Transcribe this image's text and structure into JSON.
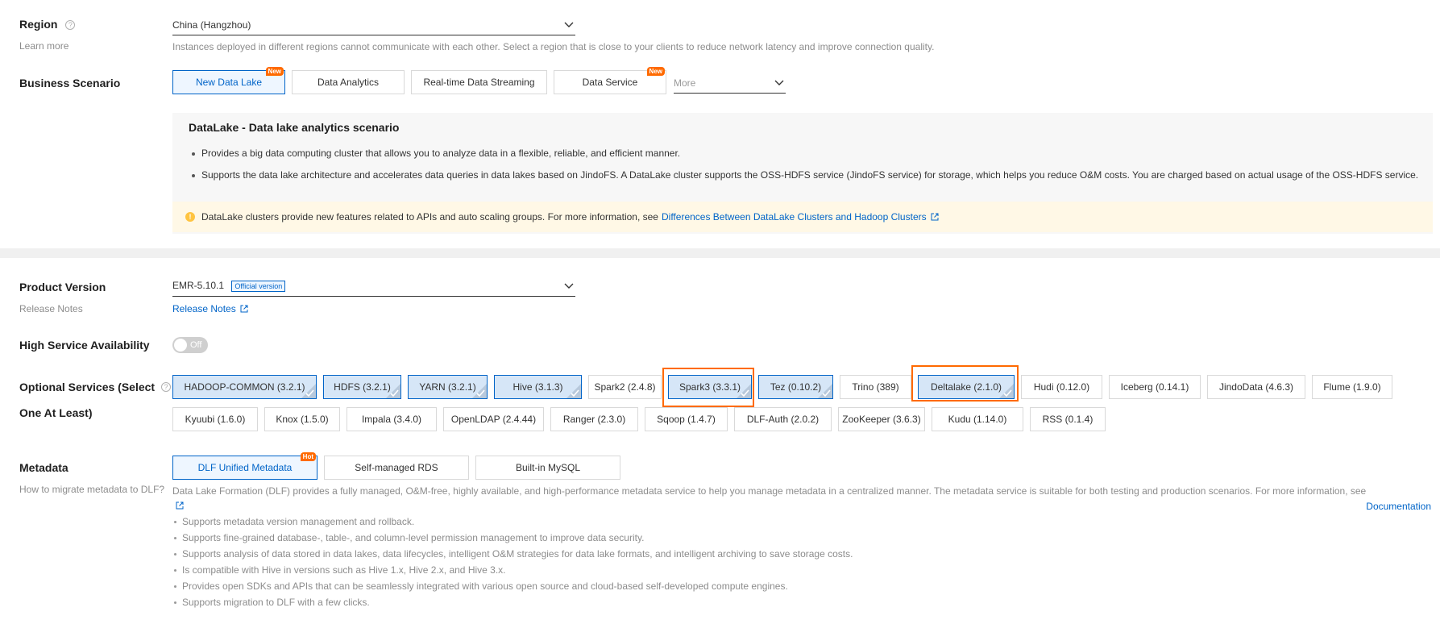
{
  "region": {
    "label": "Region",
    "learn_more": "Learn more",
    "value": "China (Hangzhou)",
    "hint": "Instances deployed in different regions cannot communicate with each other. Select a region that is close to your clients to reduce network latency and improve connection quality."
  },
  "business_scenario": {
    "label": "Business Scenario",
    "options": [
      {
        "label": "New Data Lake",
        "badge": "New",
        "selected": true
      },
      {
        "label": "Data Analytics"
      },
      {
        "label": "Real-time Data Streaming"
      },
      {
        "label": "Data Service",
        "badge": "New"
      }
    ],
    "more_placeholder": "More",
    "description": {
      "title": "DataLake - Data lake analytics scenario",
      "bullets": [
        "Provides a big data computing cluster that allows you to analyze data in a flexible, reliable, and efficient manner.",
        "Supports the data lake architecture and accelerates data queries in data lakes based on JindoFS. A DataLake cluster supports the OSS-HDFS service (JindoFS service) for storage, which helps you reduce O&M costs. You are charged based on actual usage of the OSS-HDFS service."
      ],
      "notice_text": "DataLake clusters provide new features related to APIs and auto scaling groups. For more information, see",
      "notice_link": "Differences Between DataLake Clusters and Hadoop Clusters"
    }
  },
  "product_version": {
    "label": "Product Version",
    "sub": "Release Notes",
    "value": "EMR-5.10.1",
    "tag": "Official version",
    "link": "Release Notes"
  },
  "ha": {
    "label": "High Service Availability",
    "toggle": "Off"
  },
  "optional_services": {
    "label_line1": "Optional Services (Select",
    "label_line2": "One At Least)",
    "row1": [
      {
        "label": "HADOOP-COMMON (3.2.1)",
        "checked": true
      },
      {
        "label": "HDFS (3.2.1)",
        "checked": true
      },
      {
        "label": "YARN (3.2.1)",
        "checked": true
      },
      {
        "label": "Hive (3.1.3)",
        "checked": true
      },
      {
        "label": "Spark2 (2.4.8)"
      },
      {
        "label": "Spark3 (3.3.1)",
        "checked": true
      },
      {
        "label": "Tez (0.10.2)",
        "checked": true
      },
      {
        "label": "Trino (389)"
      },
      {
        "label": "Deltalake (2.1.0)",
        "checked": true
      },
      {
        "label": "Hudi (0.12.0)"
      },
      {
        "label": "Iceberg (0.14.1)"
      },
      {
        "label": "JindoData (4.6.3)"
      },
      {
        "label": "Flume (1.9.0)"
      }
    ],
    "row2": [
      {
        "label": "Kyuubi (1.6.0)"
      },
      {
        "label": "Knox (1.5.0)"
      },
      {
        "label": "Impala (3.4.0)"
      },
      {
        "label": "OpenLDAP (2.4.44)"
      },
      {
        "label": "Ranger (2.3.0)"
      },
      {
        "label": "Sqoop (1.4.7)"
      },
      {
        "label": "DLF-Auth (2.0.2)"
      },
      {
        "label": "ZooKeeper (3.6.3)"
      },
      {
        "label": "Kudu (1.14.0)"
      },
      {
        "label": "RSS (0.1.4)"
      }
    ]
  },
  "metadata": {
    "label": "Metadata",
    "sub": "How to migrate metadata to DLF?",
    "options": [
      {
        "label": "DLF Unified Metadata",
        "badge": "Hot",
        "selected": true
      },
      {
        "label": "Self-managed RDS"
      },
      {
        "label": "Built-in MySQL"
      }
    ],
    "description": "Data Lake Formation (DLF) provides a fully managed, O&M-free, highly available, and high-performance metadata service to help you manage metadata in a centralized manner. The metadata service is suitable for both testing and production scenarios. For more information, see",
    "doc_link": "Documentation",
    "bullets": [
      "Supports metadata version management and rollback.",
      "Supports fine-grained database-, table-, and column-level permission management to improve data security.",
      "Supports analysis of data stored in data lakes, data lifecycles, intelligent O&M strategies for data lake formats, and intelligent archiving to save storage costs.",
      "Is compatible with Hive in versions such as Hive 1.x, Hive 2.x, and Hive 3.x.",
      "Provides open SDKs and APIs that can be seamlessly integrated with various open source and cloud-based self-developed compute engines.",
      "Supports migration to DLF with a few clicks."
    ]
  }
}
